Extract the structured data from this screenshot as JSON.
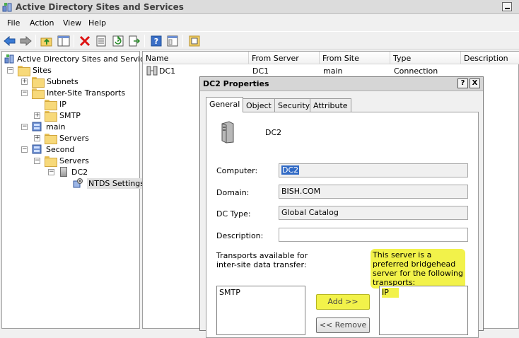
{
  "window": {
    "title": "Active Directory Sites and Services"
  },
  "menu": [
    "File",
    "Action",
    "View",
    "Help"
  ],
  "toolbar": {
    "icons": [
      "back-icon",
      "forward-icon",
      "up-folder-icon",
      "show-hide-tree-icon",
      "delete-icon",
      "properties-icon",
      "refresh-icon",
      "export-icon",
      "help-icon",
      "console-icon",
      "new-window-icon"
    ]
  },
  "tree": {
    "root": "Active Directory Sites and Services",
    "sites": "Sites",
    "subnets": "Subnets",
    "inter_site": "Inter-Site Transports",
    "ip": "IP",
    "smtp": "SMTP",
    "main": "main",
    "main_servers": "Servers",
    "second": "Second",
    "second_servers": "Servers",
    "dc2": "DC2",
    "ntds": "NTDS Settings"
  },
  "list": {
    "columns": [
      "Name",
      "From Server",
      "From Site",
      "Type",
      "Description"
    ],
    "rows": [
      {
        "name": "DC1",
        "from_server": "DC1",
        "from_site": "main",
        "type": "Connection",
        "description": ""
      }
    ]
  },
  "dialog": {
    "title": "DC2 Properties",
    "help_btn": "?",
    "close_btn": "X",
    "tabs": [
      "General",
      "Object",
      "Security",
      "Attribute Editor"
    ],
    "server_name": "DC2",
    "computer_label": "Computer:",
    "computer_value": "DC2",
    "domain_label": "Domain:",
    "domain_value": "BISH.COM",
    "dctype_label": "DC Type:",
    "dctype_value": "Global Catalog",
    "description_label": "Description:",
    "description_value": "",
    "transports_label": "Transports available for inter-site data transfer:",
    "bridgehead_label": "This server is a preferred bridgehead server for the following transports:",
    "available": [
      "SMTP"
    ],
    "preferred": [
      "IP"
    ],
    "add_btn": "Add >>",
    "remove_btn": "<< Remove"
  },
  "colors": {
    "highlight": "#f2f24a",
    "selection": "#316ac5"
  }
}
